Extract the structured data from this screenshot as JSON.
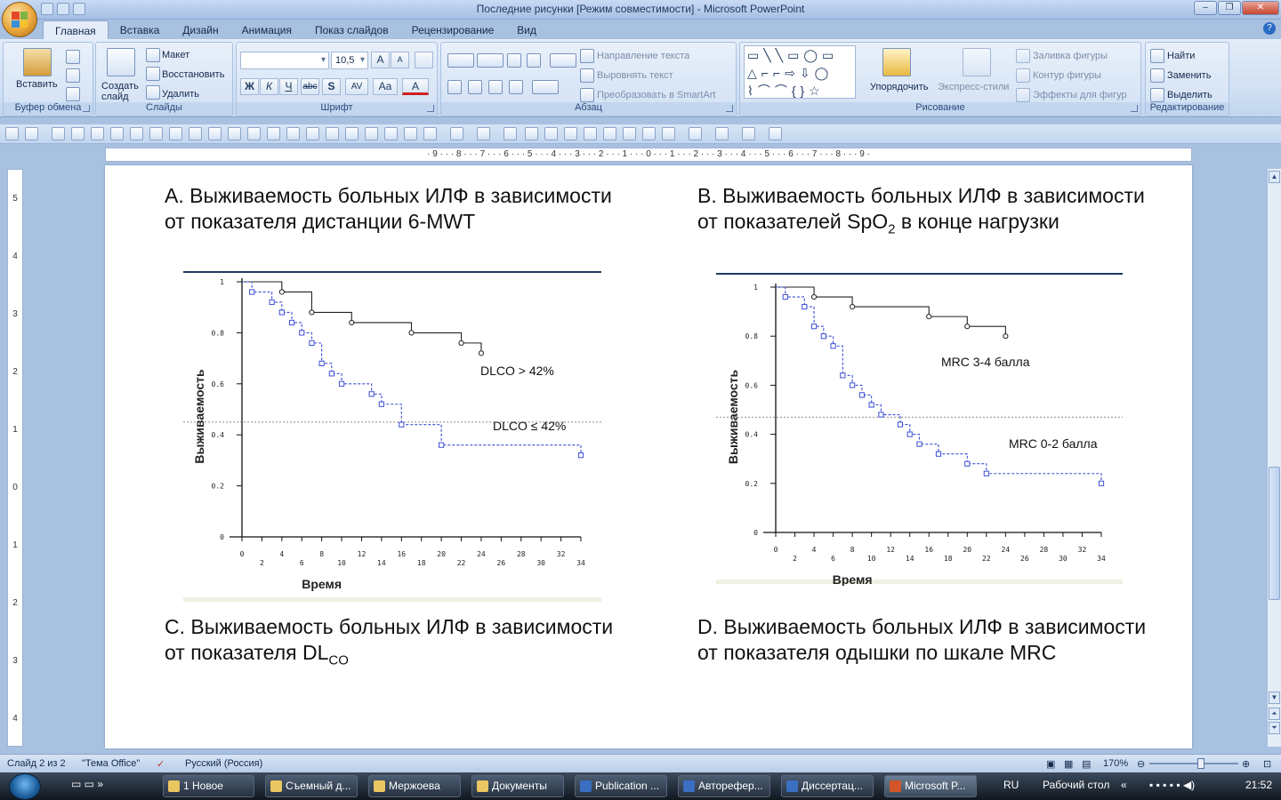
{
  "window": {
    "title": "Последние рисунки [Режим совместимости] - Microsoft PowerPoint",
    "controls": [
      "–",
      "❐",
      "✕"
    ]
  },
  "tabs": [
    "Главная",
    "Вставка",
    "Дизайн",
    "Анимация",
    "Показ слайдов",
    "Рецензирование",
    "Вид"
  ],
  "ribbon": {
    "clipboard": {
      "label": "Буфер обмена",
      "paste": "Вставить"
    },
    "slides": {
      "label": "Слайды",
      "new_slide": "Создать слайд",
      "layout": "Макет",
      "reset": "Восстановить",
      "delete": "Удалить"
    },
    "font": {
      "label": "Шрифт",
      "font_name": "",
      "font_size": "10,5",
      "bold": "Ж",
      "italic": "К",
      "underline": "Ч",
      "strike": "abc",
      "shadow": "S",
      "spacing": "AV",
      "case": "Aa",
      "color": "A",
      "grow": "A",
      "shrink": "A"
    },
    "paragraph": {
      "label": "Абзац",
      "text_direction": "Направление текста",
      "align_text": "Выровнять текст",
      "smartart": "Преобразовать в SmartArt"
    },
    "drawing": {
      "label": "Рисование",
      "arrange": "Упорядочить",
      "quick_styles": "Экспресс-стили",
      "fill": "Заливка фигуры",
      "outline": "Контур фигуры",
      "effects": "Эффекты для фигур"
    },
    "editing": {
      "label": "Редактирование",
      "find": "Найти",
      "replace": "Заменить",
      "select": "Выделить"
    }
  },
  "ruler": {
    "horizontal": "· 9 · · · 8 · · · 7 · · · 6 · · · 5 · · · 4 · · · 3 · · · 2 · · · 1 · · · 0 · · · 1 · · · 2 · · · 3 · · · 4 · · · 5 · · · 6 · · · 7 · · · 8 · · · 9 ·",
    "vertical": [
      "5",
      "4",
      "3",
      "2",
      "1",
      "0",
      "1",
      "2",
      "3",
      "4"
    ]
  },
  "slide": {
    "caption_a": [
      "A. Выживаемость больных ИЛФ в зависимости",
      "от показателя дистанции 6-MWT"
    ],
    "caption_b_line1": "B. Выживаемость больных ИЛФ в зависимости",
    "caption_b_line2_pre": "от показателей SpO",
    "caption_b_sub": "2",
    "caption_b_line2_post": " в конце нагрузки",
    "caption_c_line1": "C. Выживаемость больных ИЛФ в зависимости",
    "caption_c_line2_pre": "от показателя DL",
    "caption_c_sub": "CO",
    "caption_d": [
      "D. Выживаемость больных ИЛФ в зависимости",
      "от показателя одышки по шкале MRC"
    ]
  },
  "chart_data": [
    {
      "type": "line",
      "step": true,
      "ylabel": "Выживаемость",
      "xlabel": "Время",
      "xticks": [
        0,
        2,
        4,
        6,
        8,
        10,
        12,
        14,
        16,
        18,
        20,
        22,
        24,
        26,
        28,
        30,
        32,
        34
      ],
      "yticks": [
        "0",
        "0.2",
        "0.4",
        "0.6",
        "0.8",
        "1"
      ],
      "xlim": [
        0,
        34
      ],
      "ylim": [
        0,
        1
      ],
      "reference_line_y": 0.45,
      "series": [
        {
          "name": "DLCO > 42%",
          "color": "#222222",
          "dash": false,
          "marker": "circle",
          "x": [
            0,
            4,
            7,
            11,
            17,
            22,
            24
          ],
          "y": [
            1,
            0.96,
            0.88,
            0.84,
            0.8,
            0.76,
            0.72
          ]
        },
        {
          "name": "DLCO ≤ 42%",
          "color": "#3d4fd6",
          "dash": true,
          "marker": "square",
          "x": [
            0,
            1,
            3,
            4,
            5,
            6,
            7,
            8,
            9,
            10,
            13,
            14,
            16,
            20,
            34
          ],
          "y": [
            1,
            0.96,
            0.92,
            0.88,
            0.84,
            0.8,
            0.76,
            0.68,
            0.64,
            0.6,
            0.56,
            0.52,
            0.44,
            0.36,
            0.32
          ]
        }
      ]
    },
    {
      "type": "line",
      "step": true,
      "ylabel": "Выживаемость",
      "xlabel": "Время",
      "xticks": [
        0,
        2,
        4,
        6,
        8,
        10,
        12,
        14,
        16,
        18,
        20,
        22,
        24,
        26,
        28,
        30,
        32,
        34
      ],
      "yticks": [
        "0",
        "0.2",
        "0.4",
        "0.6",
        "0.8",
        "1"
      ],
      "xlim": [
        0,
        34
      ],
      "ylim": [
        0,
        1
      ],
      "reference_line_y": 0.47,
      "series": [
        {
          "name": "MRC 3-4 балла",
          "color": "#222222",
          "dash": false,
          "marker": "circle",
          "x": [
            0,
            4,
            8,
            16,
            20,
            24
          ],
          "y": [
            1,
            0.96,
            0.92,
            0.88,
            0.84,
            0.8
          ]
        },
        {
          "name": "MRC 0-2 балла",
          "color": "#3d4fd6",
          "dash": true,
          "marker": "square",
          "x": [
            0,
            1,
            3,
            4,
            5,
            6,
            7,
            8,
            9,
            10,
            11,
            13,
            14,
            15,
            17,
            20,
            22,
            34
          ],
          "y": [
            1,
            0.96,
            0.92,
            0.84,
            0.8,
            0.76,
            0.64,
            0.6,
            0.56,
            0.52,
            0.48,
            0.44,
            0.4,
            0.36,
            0.32,
            0.28,
            0.24,
            0.2
          ]
        }
      ]
    }
  ],
  "statusbar": {
    "slide": "Слайд 2 из 2",
    "theme": "\"Тема Office\"",
    "language": "Русский (Россия)",
    "zoom": "170%"
  },
  "taskbar": {
    "buttons": [
      "1 Новое",
      "Съемный д...",
      "Мержоева",
      "Документы",
      "Publication ...",
      "Авторефер...",
      "Диссертац...",
      "Microsoft P..."
    ],
    "lang": "RU",
    "desktop": "Рабочий стол",
    "clock": "21:52"
  }
}
